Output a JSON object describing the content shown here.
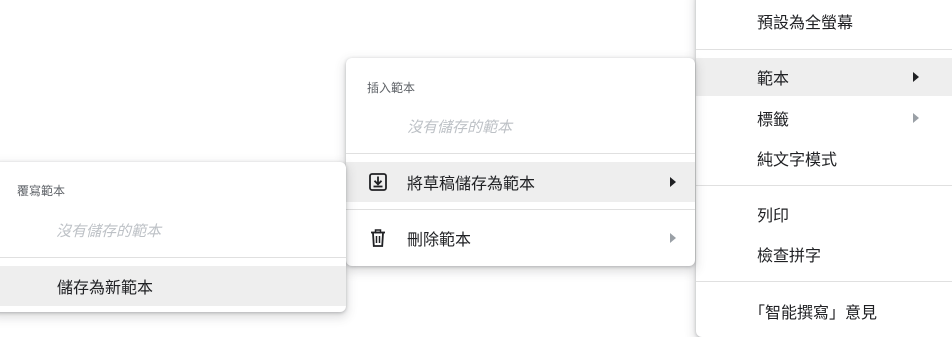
{
  "main_menu": {
    "items": [
      {
        "label": "預設為全螢幕"
      },
      {
        "label": "範本"
      },
      {
        "label": "標籤"
      },
      {
        "label": "純文字模式"
      },
      {
        "label": "列印"
      },
      {
        "label": "檢查拼字"
      },
      {
        "label": "「智能撰寫」意見"
      }
    ]
  },
  "template_menu": {
    "heading": "插入範本",
    "empty_text": "沒有儲存的範本",
    "save_draft_label": "將草稿儲存為範本",
    "delete_label": "刪除範本"
  },
  "overwrite_menu": {
    "heading": "覆寫範本",
    "empty_text": "沒有儲存的範本",
    "save_new_label": "儲存為新範本"
  },
  "colors": {
    "active_bg": "#eeeeee",
    "text": "#202124",
    "muted": "#bdc1c6",
    "heading": "#5f6368"
  },
  "icons": [
    "download-box-icon",
    "trash-icon",
    "chevron-right-icon"
  ]
}
